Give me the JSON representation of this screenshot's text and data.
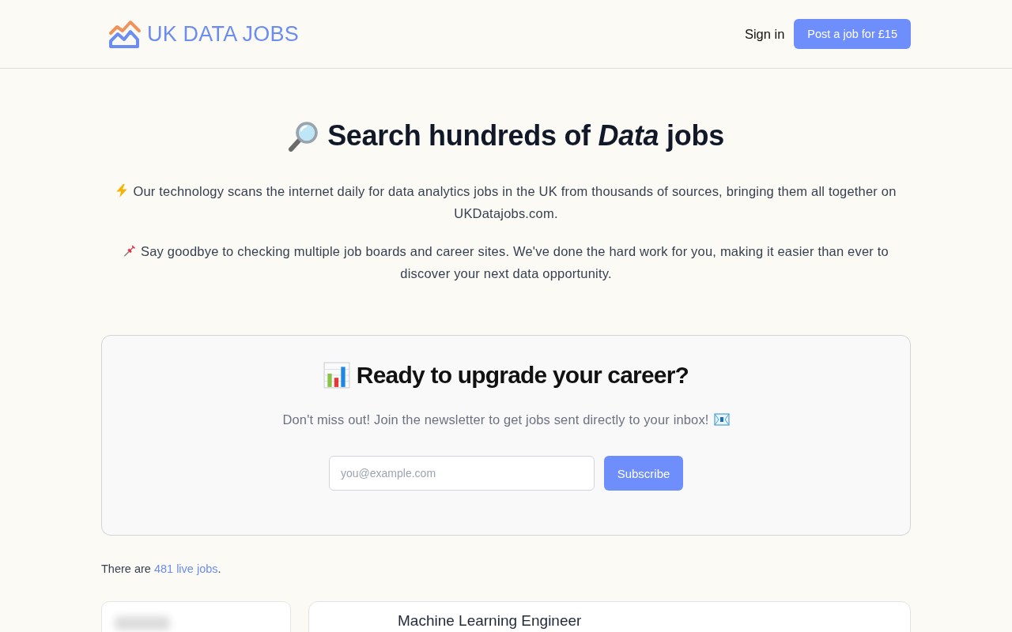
{
  "header": {
    "logo": "UK DATA JOBS",
    "sign_in": "Sign in",
    "post_button": "Post a job for £15"
  },
  "hero": {
    "title": "Search hundreds of *Data* jobs",
    "scan_note": "Our technology scans the internet daily for data analytics jobs in the UK from thousands of sources, bringing them all together on UKDatajobs.com.",
    "benefit_note": "Say goodbye to checking multiple job boards and career sites. We've done the hard work for you, making it easier than ever to discover your next data opportunity."
  },
  "newsletter": {
    "title": "Ready to upgrade your career?",
    "text": "Don't miss out! Join the newsletter to get jobs sent directly to your inbox!",
    "email": {
      "placeholder": "you@example.com"
    },
    "button": "Subscribe"
  },
  "listing": {
    "count_prefix": "There are",
    "count_link": "481 live jobs",
    "count_suffix": ".",
    "jobs": [
      {
        "title": "Machine Learning Engineer"
      }
    ]
  }
}
